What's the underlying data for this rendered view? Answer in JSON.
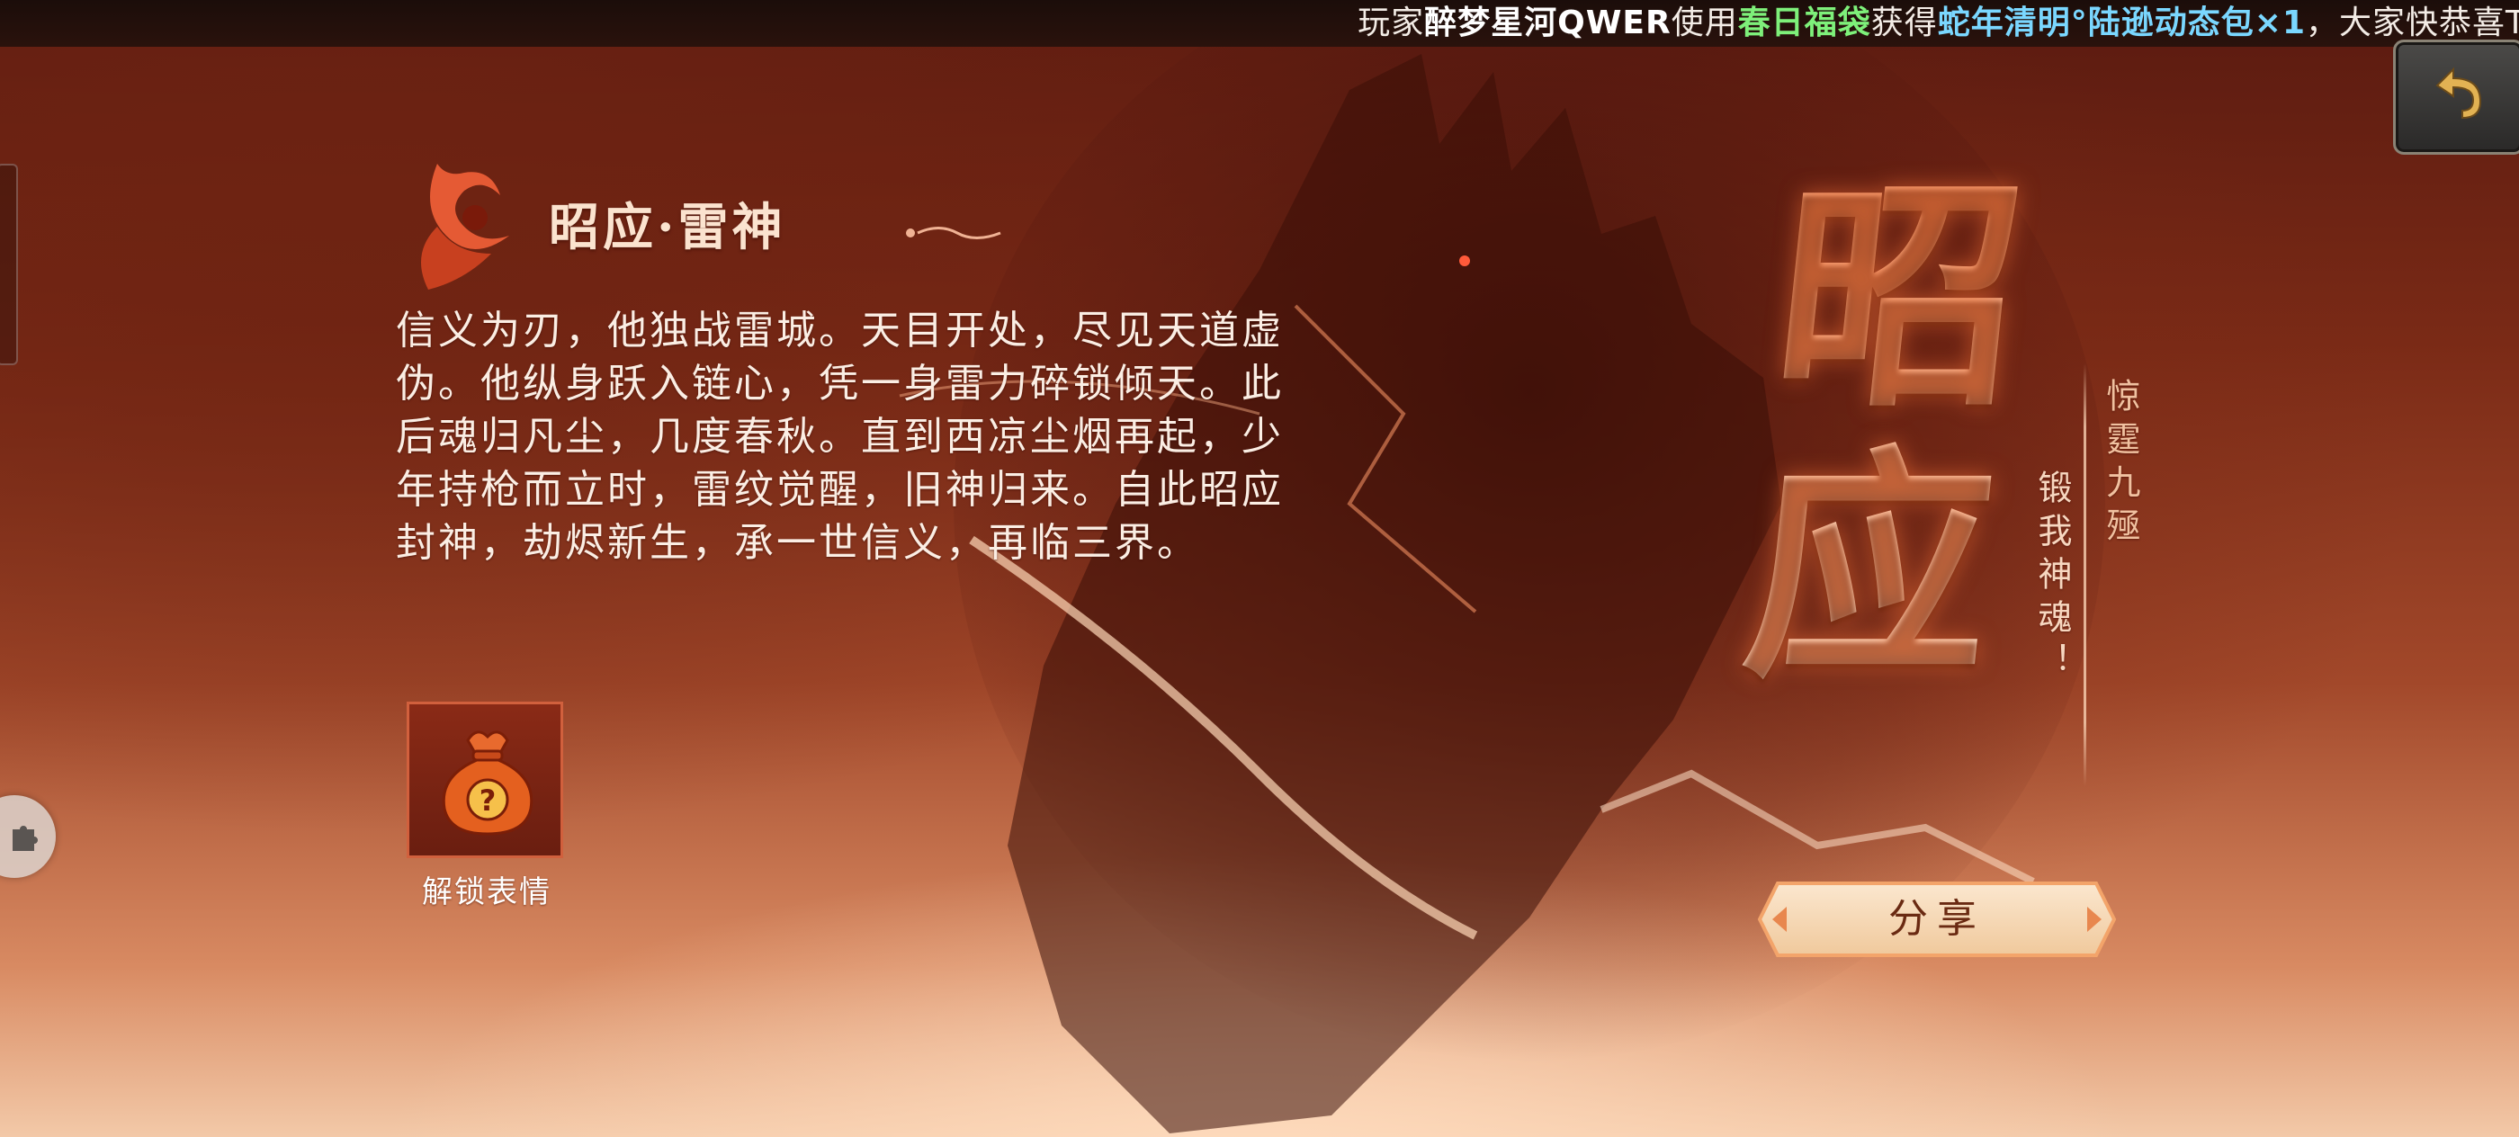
{
  "ticker": {
    "prefix": "玩家",
    "player": "醉梦星河QWER",
    "used": "使用",
    "item": "春日福袋",
    "got": "获得",
    "reward": "蛇年清明°陆逊动态包×1",
    "suffix": "，大家快恭喜T"
  },
  "hero": {
    "title": "昭应·雷神",
    "lore": "信义为刃，他独战雷城。天目开处，尽见天道虚伪。他纵身跃入链心，凭一身雷力碎锁倾天。此后魂归凡尘，几度春秋。直到西凉尘烟再起，少年持枪而立时，雷纹觉醒，旧神归来。自此昭应封神，劫烬新生，承一世信义，再临三界。",
    "name_char_1": "昭",
    "name_char_2": "应",
    "slogan_line_1": "惊霆九殛",
    "slogan_line_2": "锻我神魂！"
  },
  "emote": {
    "label": "解锁表情",
    "icon": "mystery-bag-icon"
  },
  "buttons": {
    "share_label": "分享",
    "back_icon": "back-arrow-icon"
  },
  "colors": {
    "ticker_player": "#ffffff",
    "ticker_item": "#7ef07a",
    "ticker_reward": "#7ad7ff",
    "accent": "#d1603d",
    "share_button": "#f6d9b6"
  }
}
